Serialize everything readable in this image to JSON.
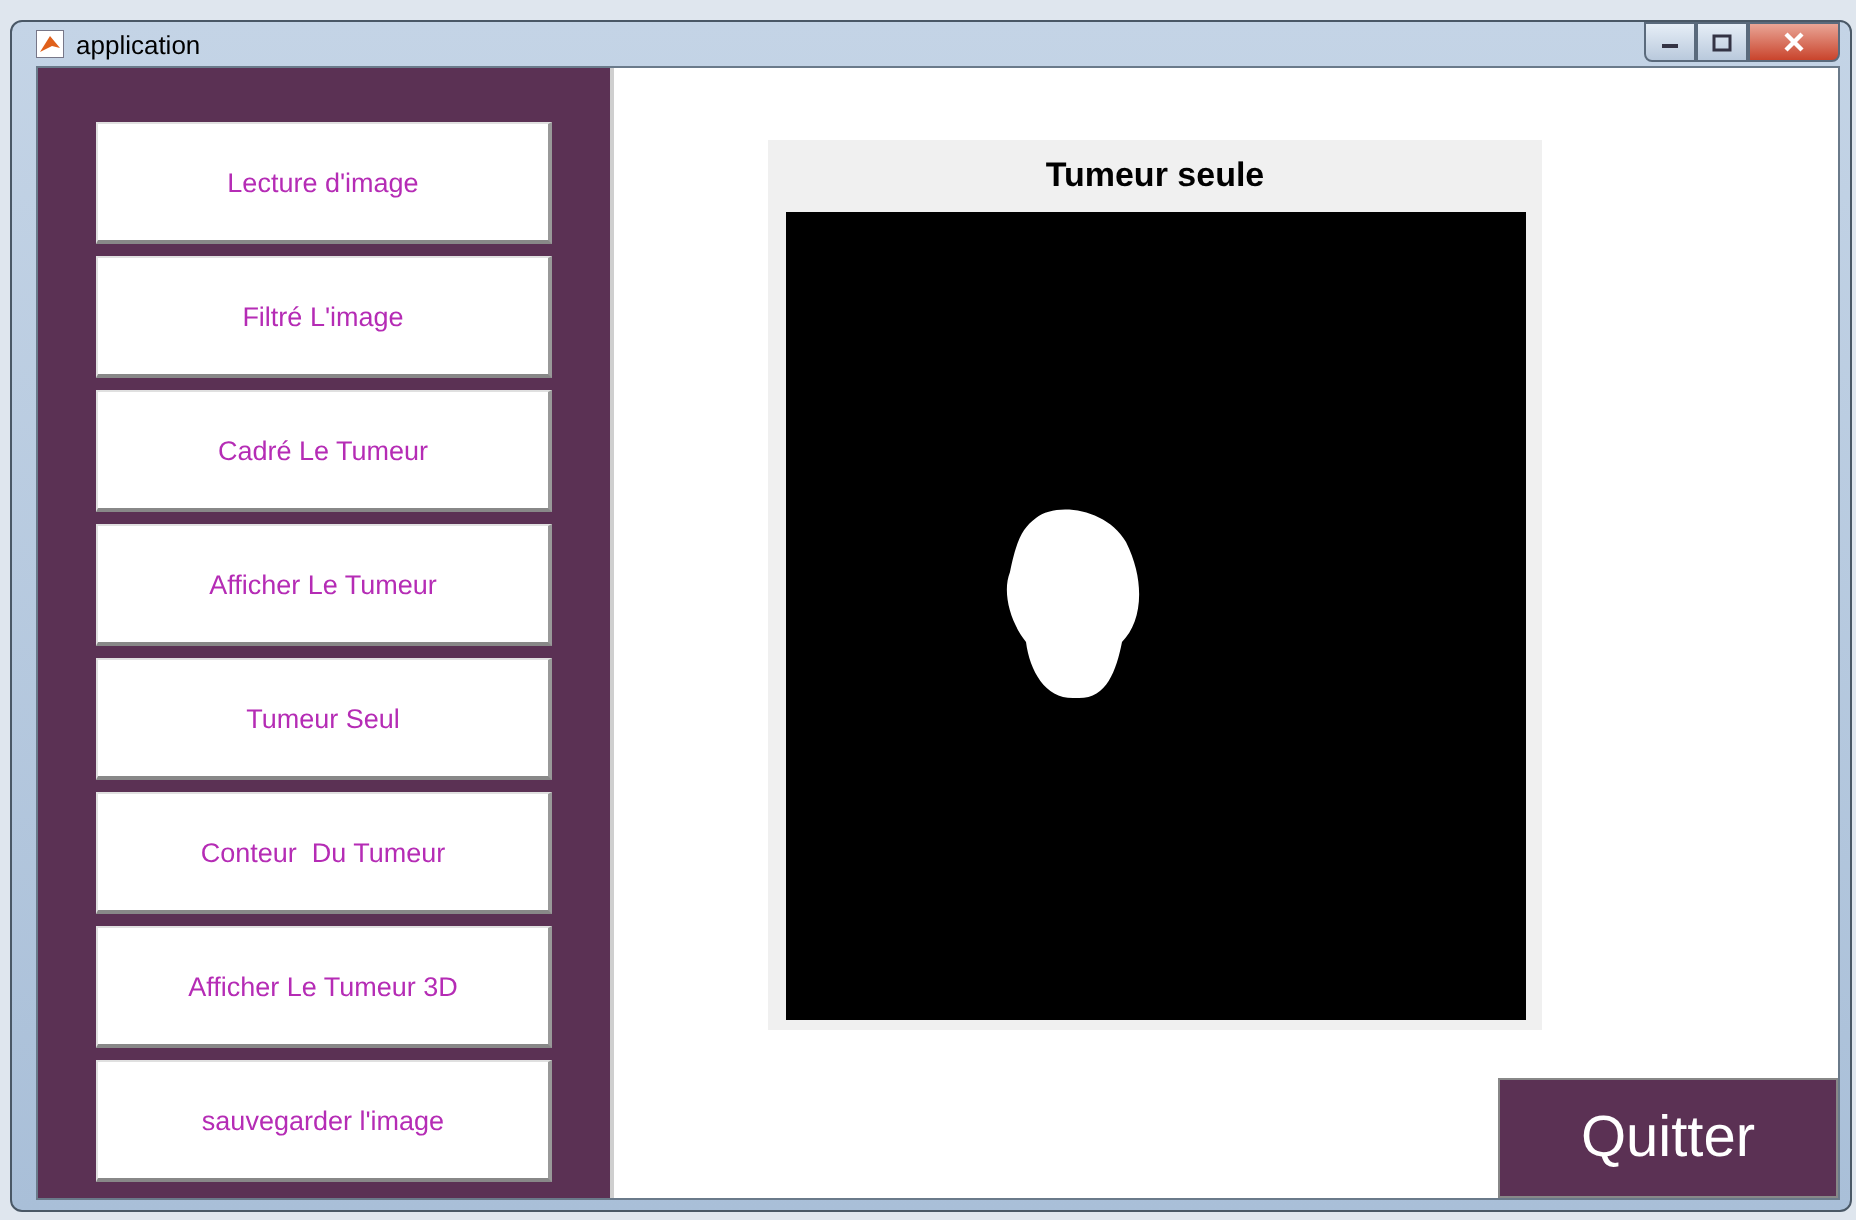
{
  "window": {
    "title": "application"
  },
  "sidebar": {
    "buttons": [
      "Lecture d'image",
      "Filtré L'image",
      "Cadré Le Tumeur",
      "Afficher Le Tumeur",
      "Tumeur Seul",
      "Conteur  Du Tumeur",
      "Afficher Le Tumeur 3D",
      "sauvegarder l'image"
    ]
  },
  "axes": {
    "title": "Tumeur seule"
  },
  "quit_button": "Quitter"
}
